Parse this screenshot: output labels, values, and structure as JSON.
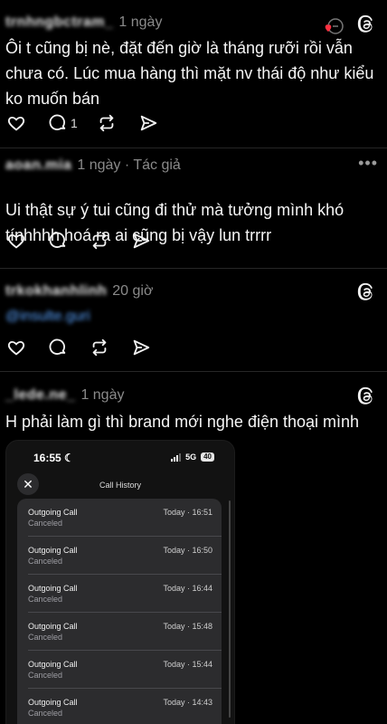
{
  "posts": [
    {
      "username": "trnhngbctram_",
      "time": "1 ngày",
      "body": "Ôi t cũng bị nè, đặt đến giờ là tháng rưỡi rồi vẫn chưa có. Lúc mua hàng thì mặt nv thái độ như kiểu ko muốn bán",
      "reply_count": "1"
    },
    {
      "username": "aoan.mia",
      "time": "1 ngày · Tác giả",
      "body": "Ui thật sự ý tui cũng đi thử mà tưởng mình khó tínhhhh hoá ra ai cũng bị vậy lun trrrr",
      "more": "•••"
    },
    {
      "username": "trkokhanhlinh",
      "time": "20 giờ",
      "mention": "@insulte.guri"
    },
    {
      "username": "_lede.ne_",
      "time": "1 ngày",
      "body": "H phải làm gì thì brand mới nghe điện thoại mình"
    }
  ],
  "screenshot": {
    "status_time": "16:55",
    "network": "5G",
    "battery": "40",
    "close": "✕",
    "title": "Call History",
    "calls": [
      {
        "title": "Outgoing Call",
        "status": "Canceled",
        "time": "Today · 16:51"
      },
      {
        "title": "Outgoing Call",
        "status": "Canceled",
        "time": "Today · 16:50"
      },
      {
        "title": "Outgoing Call",
        "status": "Canceled",
        "time": "Today · 16:44"
      },
      {
        "title": "Outgoing Call",
        "status": "Canceled",
        "time": "Today · 15:48"
      },
      {
        "title": "Outgoing Call",
        "status": "Canceled",
        "time": "Today · 15:44"
      },
      {
        "title": "Outgoing Call",
        "status": "Canceled",
        "time": "Today · 14:43"
      }
    ]
  },
  "colors": {
    "background": "#000000",
    "like_red": "#ff3040",
    "mention_blue": "#5aa3ff"
  }
}
